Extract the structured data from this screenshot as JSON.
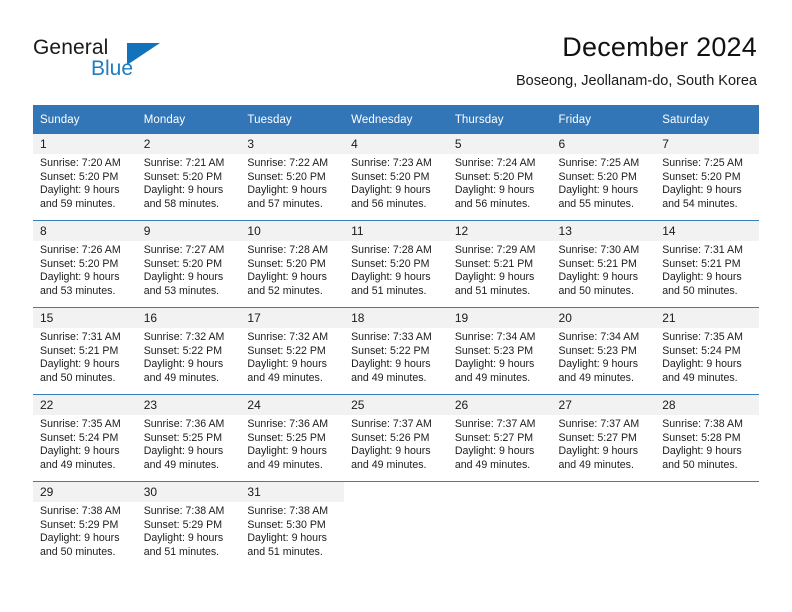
{
  "brand": {
    "word1": "General",
    "word2": "Blue",
    "triangle_color": "#1273bb",
    "blue_color": "#1f7dc0"
  },
  "header": {
    "title": "December 2024",
    "location": "Boseong, Jeollanam-do, South Korea"
  },
  "theme": {
    "header_bg": "#3276b8",
    "daynum_bg": "#f2f2f2",
    "row_divider": "#3b7cbb"
  },
  "weekdays": [
    "Sunday",
    "Monday",
    "Tuesday",
    "Wednesday",
    "Thursday",
    "Friday",
    "Saturday"
  ],
  "weeks": [
    [
      {
        "day": "1",
        "sunrise": "Sunrise: 7:20 AM",
        "sunset": "Sunset: 5:20 PM",
        "daylight1": "Daylight: 9 hours",
        "daylight2": "and 59 minutes."
      },
      {
        "day": "2",
        "sunrise": "Sunrise: 7:21 AM",
        "sunset": "Sunset: 5:20 PM",
        "daylight1": "Daylight: 9 hours",
        "daylight2": "and 58 minutes."
      },
      {
        "day": "3",
        "sunrise": "Sunrise: 7:22 AM",
        "sunset": "Sunset: 5:20 PM",
        "daylight1": "Daylight: 9 hours",
        "daylight2": "and 57 minutes."
      },
      {
        "day": "4",
        "sunrise": "Sunrise: 7:23 AM",
        "sunset": "Sunset: 5:20 PM",
        "daylight1": "Daylight: 9 hours",
        "daylight2": "and 56 minutes."
      },
      {
        "day": "5",
        "sunrise": "Sunrise: 7:24 AM",
        "sunset": "Sunset: 5:20 PM",
        "daylight1": "Daylight: 9 hours",
        "daylight2": "and 56 minutes."
      },
      {
        "day": "6",
        "sunrise": "Sunrise: 7:25 AM",
        "sunset": "Sunset: 5:20 PM",
        "daylight1": "Daylight: 9 hours",
        "daylight2": "and 55 minutes."
      },
      {
        "day": "7",
        "sunrise": "Sunrise: 7:25 AM",
        "sunset": "Sunset: 5:20 PM",
        "daylight1": "Daylight: 9 hours",
        "daylight2": "and 54 minutes."
      }
    ],
    [
      {
        "day": "8",
        "sunrise": "Sunrise: 7:26 AM",
        "sunset": "Sunset: 5:20 PM",
        "daylight1": "Daylight: 9 hours",
        "daylight2": "and 53 minutes."
      },
      {
        "day": "9",
        "sunrise": "Sunrise: 7:27 AM",
        "sunset": "Sunset: 5:20 PM",
        "daylight1": "Daylight: 9 hours",
        "daylight2": "and 53 minutes."
      },
      {
        "day": "10",
        "sunrise": "Sunrise: 7:28 AM",
        "sunset": "Sunset: 5:20 PM",
        "daylight1": "Daylight: 9 hours",
        "daylight2": "and 52 minutes."
      },
      {
        "day": "11",
        "sunrise": "Sunrise: 7:28 AM",
        "sunset": "Sunset: 5:20 PM",
        "daylight1": "Daylight: 9 hours",
        "daylight2": "and 51 minutes."
      },
      {
        "day": "12",
        "sunrise": "Sunrise: 7:29 AM",
        "sunset": "Sunset: 5:21 PM",
        "daylight1": "Daylight: 9 hours",
        "daylight2": "and 51 minutes."
      },
      {
        "day": "13",
        "sunrise": "Sunrise: 7:30 AM",
        "sunset": "Sunset: 5:21 PM",
        "daylight1": "Daylight: 9 hours",
        "daylight2": "and 50 minutes."
      },
      {
        "day": "14",
        "sunrise": "Sunrise: 7:31 AM",
        "sunset": "Sunset: 5:21 PM",
        "daylight1": "Daylight: 9 hours",
        "daylight2": "and 50 minutes."
      }
    ],
    [
      {
        "day": "15",
        "sunrise": "Sunrise: 7:31 AM",
        "sunset": "Sunset: 5:21 PM",
        "daylight1": "Daylight: 9 hours",
        "daylight2": "and 50 minutes."
      },
      {
        "day": "16",
        "sunrise": "Sunrise: 7:32 AM",
        "sunset": "Sunset: 5:22 PM",
        "daylight1": "Daylight: 9 hours",
        "daylight2": "and 49 minutes."
      },
      {
        "day": "17",
        "sunrise": "Sunrise: 7:32 AM",
        "sunset": "Sunset: 5:22 PM",
        "daylight1": "Daylight: 9 hours",
        "daylight2": "and 49 minutes."
      },
      {
        "day": "18",
        "sunrise": "Sunrise: 7:33 AM",
        "sunset": "Sunset: 5:22 PM",
        "daylight1": "Daylight: 9 hours",
        "daylight2": "and 49 minutes."
      },
      {
        "day": "19",
        "sunrise": "Sunrise: 7:34 AM",
        "sunset": "Sunset: 5:23 PM",
        "daylight1": "Daylight: 9 hours",
        "daylight2": "and 49 minutes."
      },
      {
        "day": "20",
        "sunrise": "Sunrise: 7:34 AM",
        "sunset": "Sunset: 5:23 PM",
        "daylight1": "Daylight: 9 hours",
        "daylight2": "and 49 minutes."
      },
      {
        "day": "21",
        "sunrise": "Sunrise: 7:35 AM",
        "sunset": "Sunset: 5:24 PM",
        "daylight1": "Daylight: 9 hours",
        "daylight2": "and 49 minutes."
      }
    ],
    [
      {
        "day": "22",
        "sunrise": "Sunrise: 7:35 AM",
        "sunset": "Sunset: 5:24 PM",
        "daylight1": "Daylight: 9 hours",
        "daylight2": "and 49 minutes."
      },
      {
        "day": "23",
        "sunrise": "Sunrise: 7:36 AM",
        "sunset": "Sunset: 5:25 PM",
        "daylight1": "Daylight: 9 hours",
        "daylight2": "and 49 minutes."
      },
      {
        "day": "24",
        "sunrise": "Sunrise: 7:36 AM",
        "sunset": "Sunset: 5:25 PM",
        "daylight1": "Daylight: 9 hours",
        "daylight2": "and 49 minutes."
      },
      {
        "day": "25",
        "sunrise": "Sunrise: 7:37 AM",
        "sunset": "Sunset: 5:26 PM",
        "daylight1": "Daylight: 9 hours",
        "daylight2": "and 49 minutes."
      },
      {
        "day": "26",
        "sunrise": "Sunrise: 7:37 AM",
        "sunset": "Sunset: 5:27 PM",
        "daylight1": "Daylight: 9 hours",
        "daylight2": "and 49 minutes."
      },
      {
        "day": "27",
        "sunrise": "Sunrise: 7:37 AM",
        "sunset": "Sunset: 5:27 PM",
        "daylight1": "Daylight: 9 hours",
        "daylight2": "and 49 minutes."
      },
      {
        "day": "28",
        "sunrise": "Sunrise: 7:38 AM",
        "sunset": "Sunset: 5:28 PM",
        "daylight1": "Daylight: 9 hours",
        "daylight2": "and 50 minutes."
      }
    ],
    [
      {
        "day": "29",
        "sunrise": "Sunrise: 7:38 AM",
        "sunset": "Sunset: 5:29 PM",
        "daylight1": "Daylight: 9 hours",
        "daylight2": "and 50 minutes."
      },
      {
        "day": "30",
        "sunrise": "Sunrise: 7:38 AM",
        "sunset": "Sunset: 5:29 PM",
        "daylight1": "Daylight: 9 hours",
        "daylight2": "and 51 minutes."
      },
      {
        "day": "31",
        "sunrise": "Sunrise: 7:38 AM",
        "sunset": "Sunset: 5:30 PM",
        "daylight1": "Daylight: 9 hours",
        "daylight2": "and 51 minutes."
      },
      {
        "day": "",
        "sunrise": "",
        "sunset": "",
        "daylight1": "",
        "daylight2": ""
      },
      {
        "day": "",
        "sunrise": "",
        "sunset": "",
        "daylight1": "",
        "daylight2": ""
      },
      {
        "day": "",
        "sunrise": "",
        "sunset": "",
        "daylight1": "",
        "daylight2": ""
      },
      {
        "day": "",
        "sunrise": "",
        "sunset": "",
        "daylight1": "",
        "daylight2": ""
      }
    ]
  ]
}
